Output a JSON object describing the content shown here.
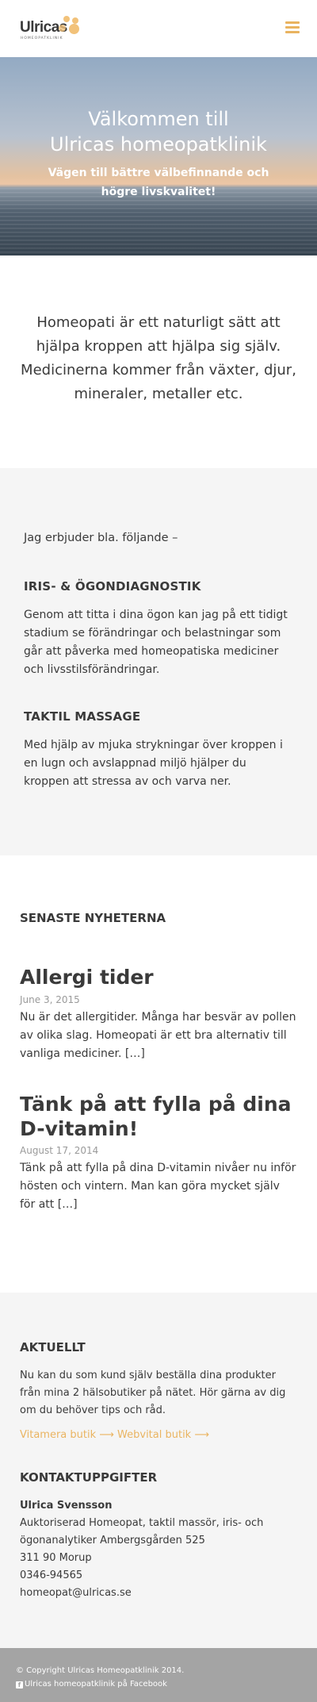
{
  "brand": {
    "name": "Ulricas",
    "tagline": "HOMEOPATKLINIK",
    "accent_color": "#eab461"
  },
  "header": {
    "menu_icon": "hamburger-menu-icon"
  },
  "hero": {
    "title_line1": "Välkommen till",
    "title_line2": "Ulricas homeopatklinik",
    "subtitle": "Vägen till bättre välbefinnande och högre livskvalitet!"
  },
  "intro": {
    "text": "Homeopati är ett naturligt sätt att hjälpa kroppen att hjälpa sig själv. Medicinerna kommer från växter, djur, mineraler, metaller etc."
  },
  "services": {
    "lead": "Jag erbjuder bla. följande –",
    "items": [
      {
        "heading": "IRIS- & ÖGONDIAGNOSTIK",
        "text": "Genom att titta i dina ögon kan jag på ett tidigt stadium se förändringar och belastningar som går att påverka med homeopatiska mediciner och livsstilsförändringar."
      },
      {
        "heading": "TAKTIL MASSAGE",
        "text": "Med hjälp av mjuka strykningar över kroppen i en lugn och avslappnad miljö hjälper du kroppen att stressa av och varva ner."
      }
    ]
  },
  "news": {
    "heading": "SENASTE NYHETERNA",
    "posts": [
      {
        "title": "Allergi tider",
        "date": "June 3, 2015",
        "excerpt": "Nu är det allergitider. Många har besvär av pollen av olika slag. Homeopati är ett bra alternativ till vanliga mediciner. […]"
      },
      {
        "title": "Tänk på att fylla på dina D-vitamin!",
        "date": "August 17, 2014",
        "excerpt": "Tänk på att fylla på dina D-vitamin nivåer nu inför hösten och vintern. Man kan göra mycket själv för att […]"
      }
    ]
  },
  "aktuellt": {
    "heading": "AKTUELLT",
    "text": "Nu kan du som kund själv beställa dina produkter från mina 2 hälsobutiker på nätet. Hör gärna av dig om du behöver tips och råd.",
    "link1": "Vitamera butik ⟶",
    "link2": "Webvital butik ⟶"
  },
  "contact": {
    "heading": "KONTAKTUPPGIFTER",
    "name": "Ulrica Svensson",
    "role": "Auktoriserad Homeopat, taktil massör, iris- och ögonanalytiker Ambergsgården 525",
    "postal": "311 90 Morup",
    "phone": "0346-94565",
    "email": "homeopat@ulricas.se"
  },
  "footer": {
    "copyright": "© Copyright Ulricas Homeopatklinik 2014.",
    "facebook": "Ulricas homeopatklinik på Facebook",
    "facebook_icon": "facebook-icon"
  }
}
